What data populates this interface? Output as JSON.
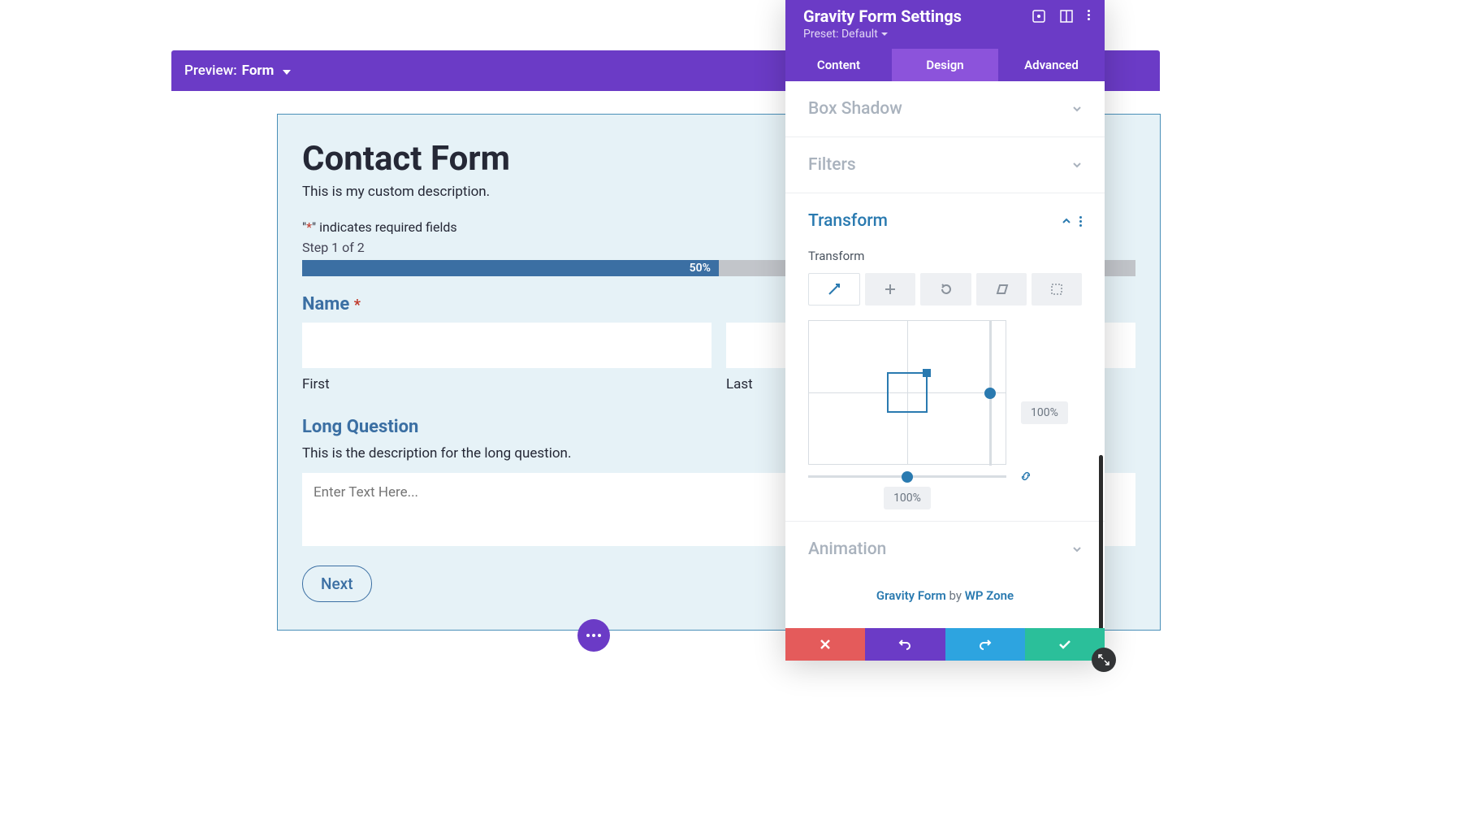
{
  "preview": {
    "label": "Preview:",
    "value": "Form"
  },
  "form": {
    "title": "Contact Form",
    "description": "This is my custom description.",
    "required_note_prefix": "\"",
    "required_note_asterisk": "*",
    "required_note_suffix": "\" indicates required fields",
    "step_text": "Step 1 of 2",
    "progress_pct": "50%",
    "name": {
      "label": "Name",
      "required_marker": "*",
      "first_sub": "First",
      "last_sub": "Last",
      "first_value": "",
      "last_value": ""
    },
    "long": {
      "label": "Long Question",
      "description": "This is the description for the long question.",
      "placeholder": "Enter Text Here...",
      "value": ""
    },
    "next_label": "Next"
  },
  "panel": {
    "title": "Gravity Form Settings",
    "preset_label": "Preset:",
    "preset_value": "Default",
    "tabs": {
      "content": "Content",
      "design": "Design",
      "advanced": "Advanced"
    },
    "sections": {
      "box_shadow": "Box Shadow",
      "filters": "Filters",
      "transform": "Transform",
      "animation": "Animation"
    },
    "transform": {
      "label": "Transform",
      "v_pct": "100%",
      "h_pct": "100%"
    },
    "footer": {
      "brand": "Gravity Form",
      "by": " by ",
      "author": "WP Zone"
    }
  }
}
